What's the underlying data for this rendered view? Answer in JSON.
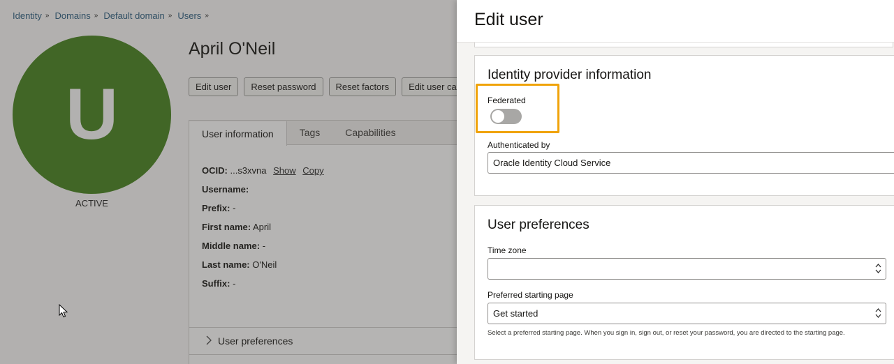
{
  "breadcrumb": [
    "Identity",
    "Domains",
    "Default domain",
    "Users"
  ],
  "breadcrumb_sep": "»",
  "avatar": {
    "letter": "U",
    "color": "#44821c"
  },
  "status": "ACTIVE",
  "user_name": "April O'Neil",
  "actions": [
    "Edit user",
    "Reset password",
    "Reset factors",
    "Edit user capa"
  ],
  "tabs": [
    "User information",
    "Tags",
    "Capabilities"
  ],
  "info": {
    "ocid_label": "OCID:",
    "ocid_value": "...s3xvna",
    "show": "Show",
    "copy": "Copy",
    "username_label": "Username:",
    "prefix_label": "Prefix:",
    "prefix_value": "-",
    "first_name_label": "First name:",
    "first_name_value": "April",
    "middle_name_label": "Middle name:",
    "middle_name_value": "-",
    "last_name_label": "Last name:",
    "last_name_value": "O'Neil",
    "suffix_label": "Suffix:",
    "suffix_value": "-"
  },
  "user_preferences_row": "User preferences",
  "drawer": {
    "title": "Edit user",
    "idp": {
      "title": "Identity provider information",
      "federated_label": "Federated",
      "federated_on": false,
      "auth_label": "Authenticated by",
      "auth_value": "Oracle Identity Cloud Service"
    },
    "prefs": {
      "title": "User preferences",
      "timezone_label": "Time zone",
      "timezone_value": "",
      "start_label": "Preferred starting page",
      "start_value": "Get started",
      "help": "Select a preferred starting page. When you sign in, sign out, or reset your password, you are directed to the starting page."
    }
  },
  "colors": {
    "accent_highlight": "#f0a30a",
    "link": "#2a5d80"
  }
}
